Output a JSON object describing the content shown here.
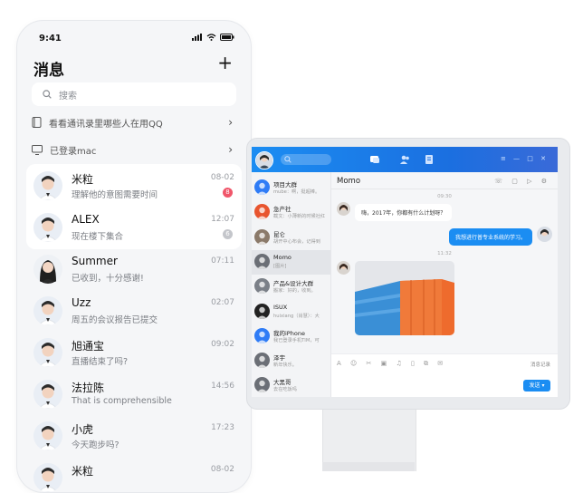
{
  "phone": {
    "status_time": "9:41",
    "title": "消息",
    "plus": "+",
    "search_placeholder": "搜索",
    "notices": [
      {
        "text": "看看通讯录里哪些人在用QQ",
        "icon": "contacts-icon"
      },
      {
        "text": "已登录mac",
        "icon": "monitor-icon"
      }
    ],
    "conversations": [
      {
        "name": "米粒",
        "message": "理解他的意图需要时间",
        "time": "08-02",
        "badge": "8",
        "badge_color": "#f0566a",
        "avatar": "man-avatar"
      },
      {
        "name": "ALEX",
        "message": "现在楼下集合",
        "time": "12:07",
        "badge": "6",
        "badge_color": "#c4c6cb",
        "avatar": "man-avatar"
      },
      {
        "name": "Summer",
        "message": "已收到，十分感谢!",
        "time": "07:11",
        "badge": "",
        "badge_color": "",
        "avatar": "woman-avatar"
      },
      {
        "name": "Uzz",
        "message": "周五的会议报告已提交",
        "time": "02:07",
        "badge": "",
        "badge_color": "",
        "avatar": "man-avatar"
      },
      {
        "name": "旭通宝",
        "message": "直播结束了吗?",
        "time": "09:02",
        "badge": "",
        "badge_color": "",
        "avatar": "man-avatar"
      },
      {
        "name": "法拉陈",
        "message": "That is comprehensible",
        "time": "14:56",
        "badge": "",
        "badge_color": "",
        "avatar": "man-avatar"
      },
      {
        "name": "小虎",
        "message": "今天跑步吗?",
        "time": "17:23",
        "badge": "",
        "badge_color": "",
        "avatar": "man-avatar"
      },
      {
        "name": "米粒",
        "message": "",
        "time": "08-02",
        "badge": "",
        "badge_color": "",
        "avatar": "man-avatar"
      }
    ]
  },
  "desktop": {
    "contacts": [
      {
        "name": "项目大群",
        "preview": "mube：啊，挺超棒。",
        "color": "#2f7cf6"
      },
      {
        "name": "急产社",
        "preview": "截文：小薄新的时候社红",
        "color": "#e8552f"
      },
      {
        "name": "昆仑",
        "preview": "胡开中心布会，记得到",
        "color": "#8b7a6a"
      },
      {
        "name": "Momo",
        "preview": "[图片]",
        "color": "#6b6f76"
      },
      {
        "name": "产品&设计大群",
        "preview": "搬家：好的，收到。",
        "color": "#7b8088"
      },
      {
        "name": "ISUX",
        "preview": "huixiang（肖慧）：大",
        "color": "#222222"
      },
      {
        "name": "我的iPhone",
        "preview": "我已登录手机TIM，可",
        "color": "#2f7cf6"
      },
      {
        "name": "泽宇",
        "preview": "新年快乐。",
        "color": "#6b6f76"
      },
      {
        "name": "大黑哥",
        "preview": "去在吃饭吗",
        "color": "#6b6f76"
      }
    ],
    "selected_contact": "Momo",
    "chat_title": "Momo",
    "messages": [
      {
        "time": "09:30"
      },
      {
        "from": "them",
        "text": "嗨，2017年，你都有什么计划呀？"
      },
      {
        "from": "me",
        "text": "我想进行普专业系统的学习。"
      },
      {
        "time": "11:32"
      },
      {
        "from": "them",
        "type": "image"
      }
    ],
    "record_label": "消息记录",
    "send_label": "发送",
    "accent": "#1b8df2"
  }
}
